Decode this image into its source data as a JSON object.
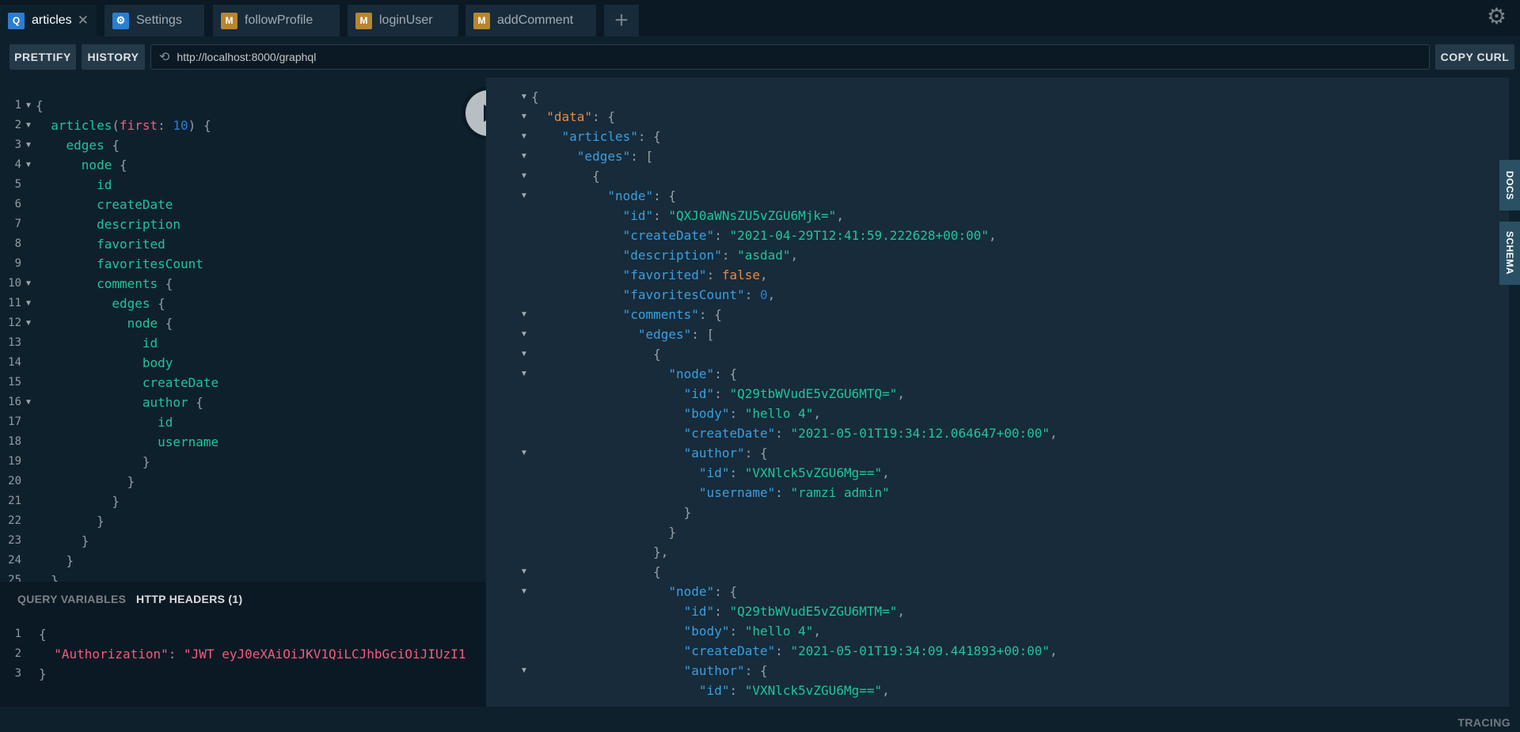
{
  "tabs": [
    {
      "label": "articles",
      "badge": "Q",
      "type": "query",
      "active": true
    },
    {
      "label": "Settings",
      "badge": "⚙",
      "type": "settings",
      "active": false
    },
    {
      "label": "followProfile",
      "badge": "M",
      "type": "mutation",
      "active": false
    },
    {
      "label": "loginUser",
      "badge": "M",
      "type": "mutation",
      "active": false
    },
    {
      "label": "addComment",
      "badge": "M",
      "type": "mutation",
      "active": false
    }
  ],
  "toolbar": {
    "prettify_label": "PRETTIFY",
    "history_label": "HISTORY",
    "url": "http://localhost:8000/graphql",
    "copy_curl_label": "COPY CURL"
  },
  "query_editor": {
    "lines": [
      "{",
      "  articles(first: 10) {",
      "    edges {",
      "      node {",
      "        id",
      "        createDate",
      "        description",
      "        favorited",
      "        favoritesCount",
      "        comments {",
      "          edges {",
      "            node {",
      "              id",
      "              body",
      "              createDate",
      "              author {",
      "                id",
      "                username",
      "              }",
      "            }",
      "          }",
      "        }",
      "      }",
      "    }",
      "  }"
    ],
    "line_numbers": [
      "1",
      "2",
      "3",
      "4",
      "5",
      "6",
      "7",
      "8",
      "9",
      "10",
      "11",
      "12",
      "13",
      "14",
      "15",
      "16",
      "17",
      "18",
      "19",
      "20",
      "21",
      "22",
      "23",
      "24",
      "25"
    ]
  },
  "vars_panel": {
    "query_variables_label": "QUERY VARIABLES",
    "http_headers_label": "HTTP HEADERS (1)",
    "line_numbers": [
      "1",
      "2",
      "3"
    ],
    "lines": [
      "{",
      "  \"Authorization\": \"JWT eyJ0eXAiOiJKV1QiLCJhbGciOiJIUzI1",
      "}"
    ]
  },
  "result": {
    "lines": [
      "{",
      "  \"data\": {",
      "    \"articles\": {",
      "      \"edges\": [",
      "        {",
      "          \"node\": {",
      "            \"id\": \"QXJ0aWNsZU5vZGU6Mjk=\",",
      "            \"createDate\": \"2021-04-29T12:41:59.222628+00:00\",",
      "            \"description\": \"asdad\",",
      "            \"favorited\": false,",
      "            \"favoritesCount\": 0,",
      "            \"comments\": {",
      "              \"edges\": [",
      "                {",
      "                  \"node\": {",
      "                    \"id\": \"Q29tbWVudE5vZGU6MTQ=\",",
      "                    \"body\": \"hello 4\",",
      "                    \"createDate\": \"2021-05-01T19:34:12.064647+00:00\",",
      "                    \"author\": {",
      "                      \"id\": \"VXNlck5vZGU6Mg==\",",
      "                      \"username\": \"ramzi admin\"",
      "                    }",
      "                  }",
      "                },",
      "                {",
      "                  \"node\": {",
      "                    \"id\": \"Q29tbWVudE5vZGU6MTM=\",",
      "                    \"body\": \"hello 4\",",
      "                    \"createDate\": \"2021-05-01T19:34:09.441893+00:00\",",
      "                    \"author\": {",
      "                      \"id\": \"VXNlck5vZGU6Mg==\","
    ]
  },
  "side_tabs": {
    "docs_label": "DOCS",
    "schema_label": "SCHEMA"
  },
  "footer": {
    "tracing_label": "TRACING"
  },
  "colors": {
    "background": "#0f202d",
    "result_background": "#172b3a",
    "query_badge": "#2a7ed2",
    "mutation_badge": "#b7862e"
  }
}
